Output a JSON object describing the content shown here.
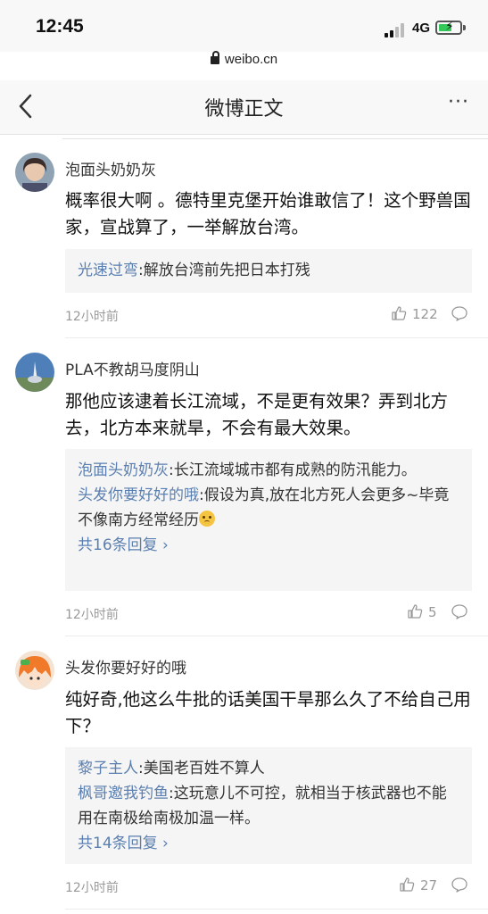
{
  "status_bar": {
    "time": "12:45",
    "network": "4G",
    "url": "weibo.cn"
  },
  "header": {
    "title": "微博正文",
    "more": "···"
  },
  "comments": [
    {
      "user": "泡面头奶奶灰",
      "text": "概率很大啊 。德特里克堡开始谁敢信了！这个野兽国家，宣战算了，一举解放台湾。",
      "replies": [
        {
          "user": "光速过弯",
          "text": ":解放台湾前先把日本打残"
        }
      ],
      "time": "12小时前",
      "likes": "122"
    },
    {
      "user": "PLA不教胡马度阴山",
      "text": "那他应该逮着长江流域，不是更有效果？弄到北方去，北方本来就旱，不会有最大效果。",
      "replies": [
        {
          "user": "泡面头奶奶灰",
          "text": ":长江流域城市都有成熟的防汛能力。"
        },
        {
          "user": "头发你要好好的哦",
          "text": ":假设为真,放在北方死人会更多~毕竟不像南方经常经历"
        }
      ],
      "more_replies": "共16条回复",
      "time": "12小时前",
      "likes": "5"
    },
    {
      "user": "头发你要好好的哦",
      "text": "纯好奇,他这么牛批的话美国干旱那么久了不给自己用下？",
      "replies": [
        {
          "user": "黎子主人",
          "text": ":美国老百姓不算人"
        },
        {
          "user": "枫哥邀我钓鱼",
          "text": ":这玩意儿不可控，就相当于核武器也不能用在南极给南极加温一样。"
        }
      ],
      "more_replies": "共14条回复",
      "time": "12小时前",
      "likes": "27"
    }
  ],
  "icons": {
    "like": "thumbs-up-icon",
    "reply": "comment-bubble-icon",
    "back": "chevron-left-icon",
    "lock": "lock-icon"
  },
  "colors": {
    "link": "#5b7fb0",
    "reply_bg": "#f5f5f5",
    "muted": "#999999"
  }
}
